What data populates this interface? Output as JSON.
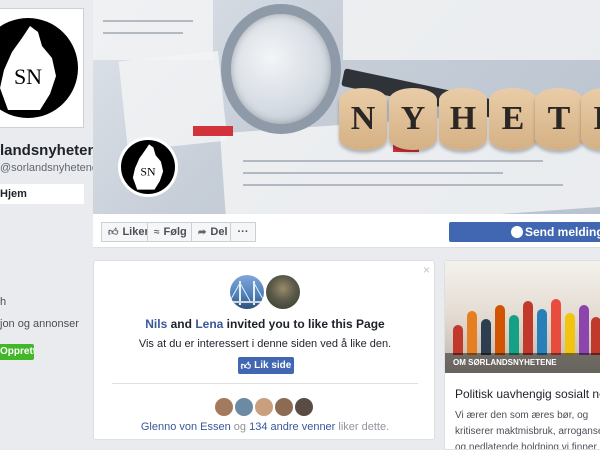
{
  "sidebar": {
    "title": "landsnyhetene",
    "handle": "@sorlandsnyhetene",
    "active_nav": "Hjem",
    "items": [
      {
        "label": "h"
      },
      {
        "label": "jon og annonser"
      }
    ],
    "create_button": "Opprett en side",
    "logo_text": "SN"
  },
  "cover": {
    "letters": [
      "N",
      "Y",
      "H",
      "E",
      "T",
      "E"
    ],
    "logo_text": "SN"
  },
  "actions": {
    "like": "Liker",
    "follow": "Følg",
    "share": "Del",
    "more": "···",
    "send_message": "Send melding"
  },
  "invite": {
    "close": "×",
    "name1": "Nils",
    "and": "and",
    "name2": "Lena",
    "rest": "invited you to like this Page",
    "subtitle": "Vis at du er interessert i denne siden ved å like den.",
    "like_button": "Lik side",
    "friend1": "Glenno von Essen",
    "og": "og",
    "friends_more": "134 andre venner",
    "suffix": "liker dette."
  },
  "right_card": {
    "image_label": "OM SØRLANDSNYHETENE",
    "title": "Politisk uavhengig sosialt netts",
    "description": "Vi ærer den som æres bør, og kritiserer maktmisbruk, arroganse og nedlatende holdning vi finner den. Vi..."
  },
  "colors": {
    "fb_blue": "#4267b2",
    "link_blue": "#385898",
    "green": "#42b72a",
    "page_bg": "#e9ebee"
  }
}
